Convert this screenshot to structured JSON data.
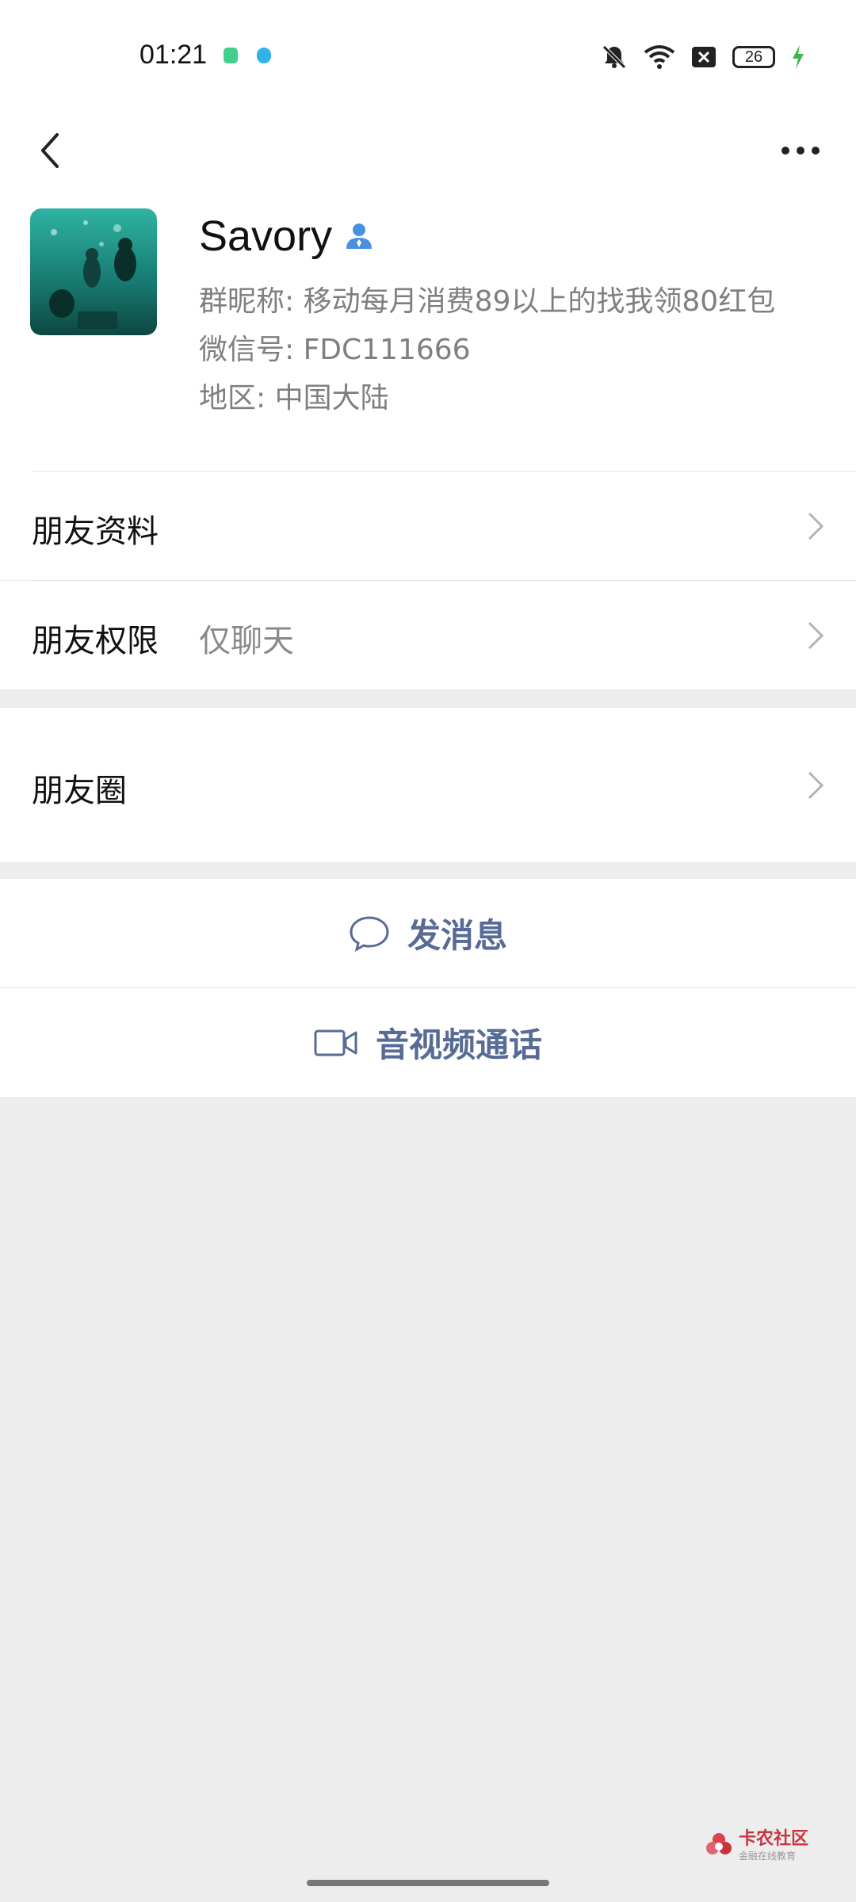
{
  "status_bar": {
    "time": "01:21",
    "battery": "26",
    "icons": [
      "mute-bell-icon",
      "wifi-icon",
      "sim-off-icon",
      "battery-icon",
      "charging-icon"
    ]
  },
  "header": {
    "back_icon": "chevron-left-icon",
    "more_icon": "more-dots-icon"
  },
  "profile": {
    "name": "Savory",
    "badge_icon": "person-badge-icon",
    "group_nickname": "群昵称:  移动每月消费89以上的找我领80红包",
    "wechat_id": "微信号:  FDC111666",
    "region": "地区:  中国大陆"
  },
  "rows": {
    "friend_info": "朋友资料",
    "friend_permission": "朋友权限",
    "friend_permission_value": "仅聊天",
    "moments": "朋友圈"
  },
  "actions": {
    "message": "发消息",
    "call": "音视频通话"
  },
  "watermark": {
    "brand": "卡农社区",
    "sub": "金融在线教育"
  },
  "colors": {
    "link_blue": "#576b95",
    "background": "#ededed",
    "badge_blue": "#4a90e2"
  }
}
